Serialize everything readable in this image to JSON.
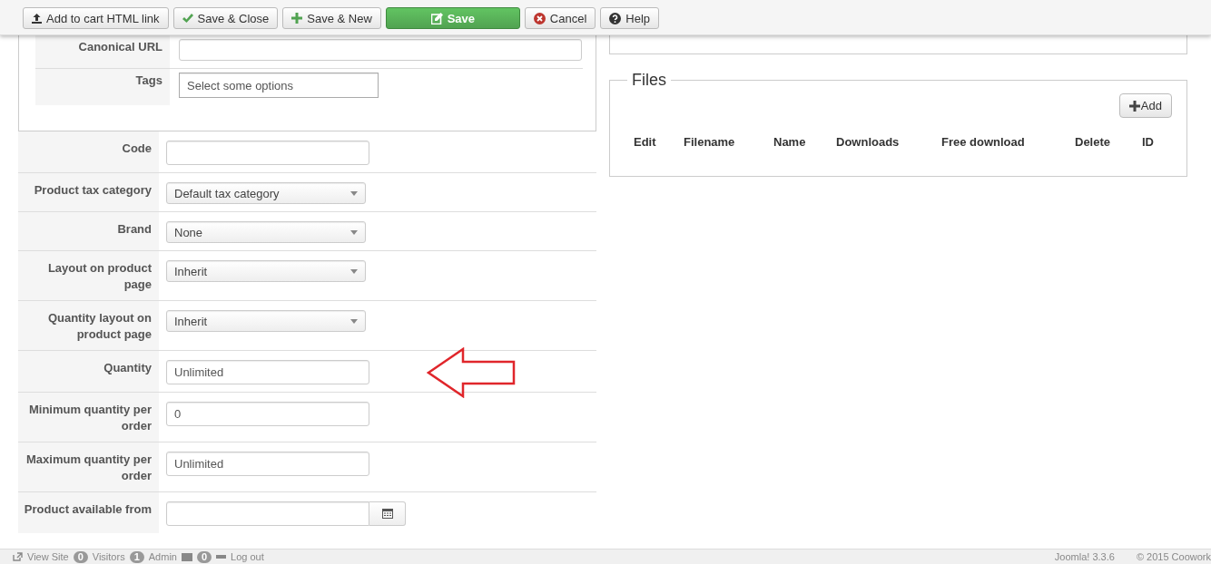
{
  "toolbar": {
    "buttons": [
      {
        "label": "Add to cart HTML link",
        "kind": "upload"
      },
      {
        "label": "Save & Close",
        "kind": "check"
      },
      {
        "label": "Save & New",
        "kind": "plus"
      },
      {
        "label": "Save",
        "kind": "save"
      },
      {
        "label": "Cancel",
        "kind": "cancel"
      },
      {
        "label": "Help",
        "kind": "help"
      }
    ]
  },
  "seo_fields": [
    {
      "label": "Canonical URL",
      "kind": "text"
    },
    {
      "label": "Tags",
      "kind": "multiselect",
      "placeholder": "Select some options"
    }
  ],
  "fields": [
    {
      "label": "Code",
      "kind": "text"
    },
    {
      "label": "Product tax category",
      "kind": "select",
      "value": "Default tax category"
    },
    {
      "label": "Brand",
      "kind": "select",
      "value": "None"
    },
    {
      "label": "Layout on product page",
      "kind": "select",
      "value": "Inherit"
    },
    {
      "label": "Quantity layout on product page",
      "kind": "select",
      "value": "Inherit"
    },
    {
      "label": "Quantity",
      "kind": "text",
      "value": "Unlimited",
      "annotated": true
    },
    {
      "label": "Minimum quantity per order",
      "kind": "text",
      "value": "0"
    },
    {
      "label": "Maximum quantity per order",
      "kind": "text",
      "value": "Unlimited"
    },
    {
      "label": "Product available from",
      "kind": "date"
    }
  ],
  "files": {
    "title": "Files",
    "add_button": "Add",
    "columns": [
      "Edit",
      "Filename",
      "Name",
      "Downloads",
      "Free download",
      "Delete",
      "ID"
    ]
  },
  "status_bar": {
    "left": [
      {
        "kind": "link",
        "label": "View Site"
      },
      {
        "kind": "count",
        "count": "0",
        "label": "Visitors"
      },
      {
        "kind": "count",
        "count": "1",
        "label": "Admin"
      },
      {
        "kind": "mail",
        "count": "0"
      },
      {
        "kind": "logout",
        "label": "Log out"
      }
    ],
    "right": [
      "Joomla! 3.3.6",
      "© 2015 Coowork"
    ]
  }
}
